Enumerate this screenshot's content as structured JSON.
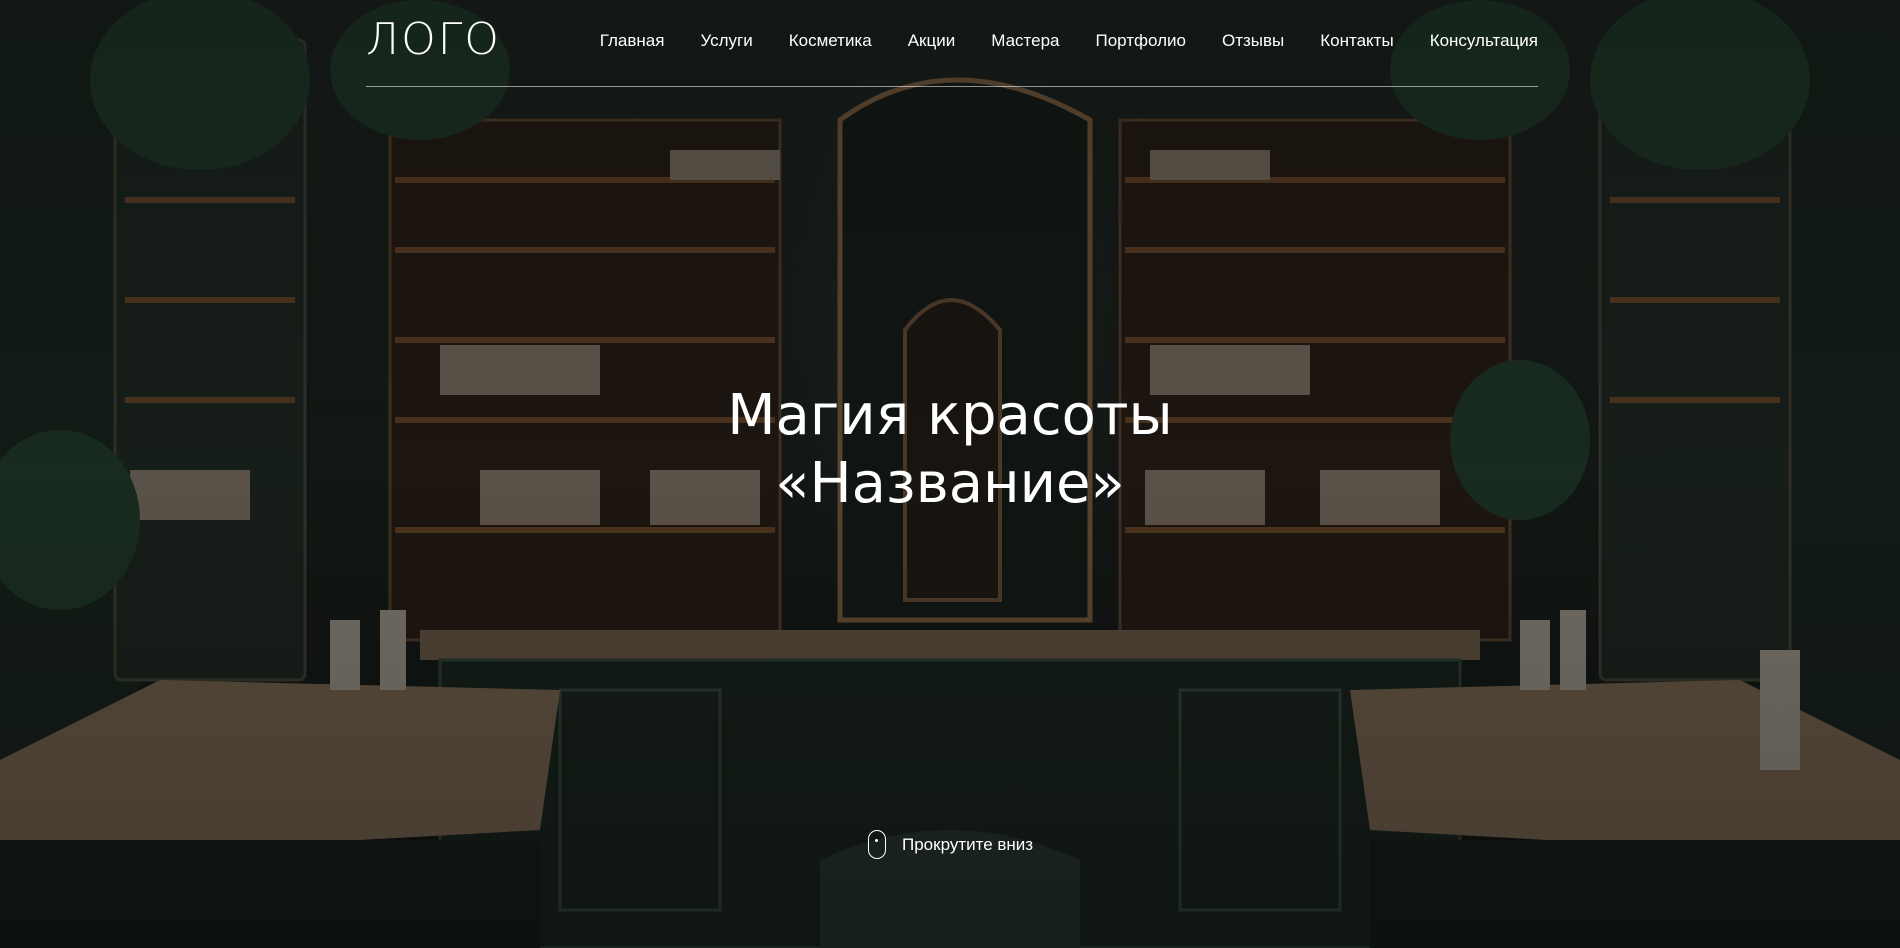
{
  "header": {
    "logo": "ЛОГО",
    "nav": [
      {
        "label": "Главная"
      },
      {
        "label": "Услуги"
      },
      {
        "label": "Косметика"
      },
      {
        "label": "Акции"
      },
      {
        "label": "Мастера"
      },
      {
        "label": "Портфолио"
      },
      {
        "label": "Отзывы"
      },
      {
        "label": "Контакты"
      },
      {
        "label": "Консультация"
      }
    ]
  },
  "hero": {
    "title_line1": "Магия красоты",
    "title_line2": "«Название»",
    "background": "dark-green-salon-interior",
    "scroll_hint": {
      "icon": "mouse-icon",
      "label": "Прокрутите вниз"
    }
  },
  "colors": {
    "text": "#ffffff",
    "background": "#141916",
    "accent_wood": "#6b4a2e",
    "accent_green": "#1f2c25"
  }
}
